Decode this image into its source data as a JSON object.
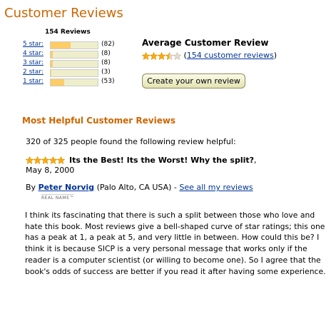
{
  "page": {
    "title": "Customer Reviews"
  },
  "histogram": {
    "total_label": "154 Reviews",
    "rows": [
      {
        "label": "5 star:",
        "count_text": "(82)",
        "count": 82,
        "fill_fraction": 0.43
      },
      {
        "label": "4 star:",
        "count_text": "(8)",
        "count": 8,
        "fill_fraction": 0.04
      },
      {
        "label": "3 star:",
        "count_text": "(8)",
        "count": 8,
        "fill_fraction": 0.04
      },
      {
        "label": "2 star:",
        "count_text": "(3)",
        "count": 3,
        "fill_fraction": 0.02
      },
      {
        "label": "1 star:",
        "count_text": "(53)",
        "count": 53,
        "fill_fraction": 0.29
      }
    ]
  },
  "average": {
    "heading": "Average Customer Review",
    "rating": 3.5,
    "link_text": "154 customer reviews",
    "open_paren": "(",
    "close_paren": ")"
  },
  "create_review_button": "Create your own review",
  "most_helpful": {
    "heading": "Most Helpful Customer Reviews"
  },
  "review": {
    "helpful_text": "320 of 325 people found the following review helpful:",
    "rating": 5,
    "title": "Its the Best! Its the Worst! Why the split?",
    "title_suffix": ",",
    "date": "May 8, 2000",
    "by_label": "By",
    "reviewer": "Peter Norvig",
    "location": "(Palo Alto, CA USA)",
    "separator": " - ",
    "see_all_link": "See all my reviews",
    "real_name_badge": "REAL NAME™",
    "body": "I think its fascinating that there is such a split between those who love and hate this book. Most reviews give a bell-shaped curve of star ratings; this one has a peak at 1, a peak at 5, and very little in between. How could this be? I think it is because SICP is a very personal message that works only if the reader is a computer scientist (or willing to become one). So I agree that the book's odds of success are better if you read it after having some experience."
  },
  "colors": {
    "heading_orange": "#cc6600",
    "link_blue": "#003399",
    "bar_fill": "#ffcc66",
    "bar_track": "#eeeecc",
    "star_color": "#ffaa00"
  },
  "icons": {
    "star_full": "star-icon",
    "star_half": "half-star-icon",
    "star_empty": "empty-star-icon"
  }
}
